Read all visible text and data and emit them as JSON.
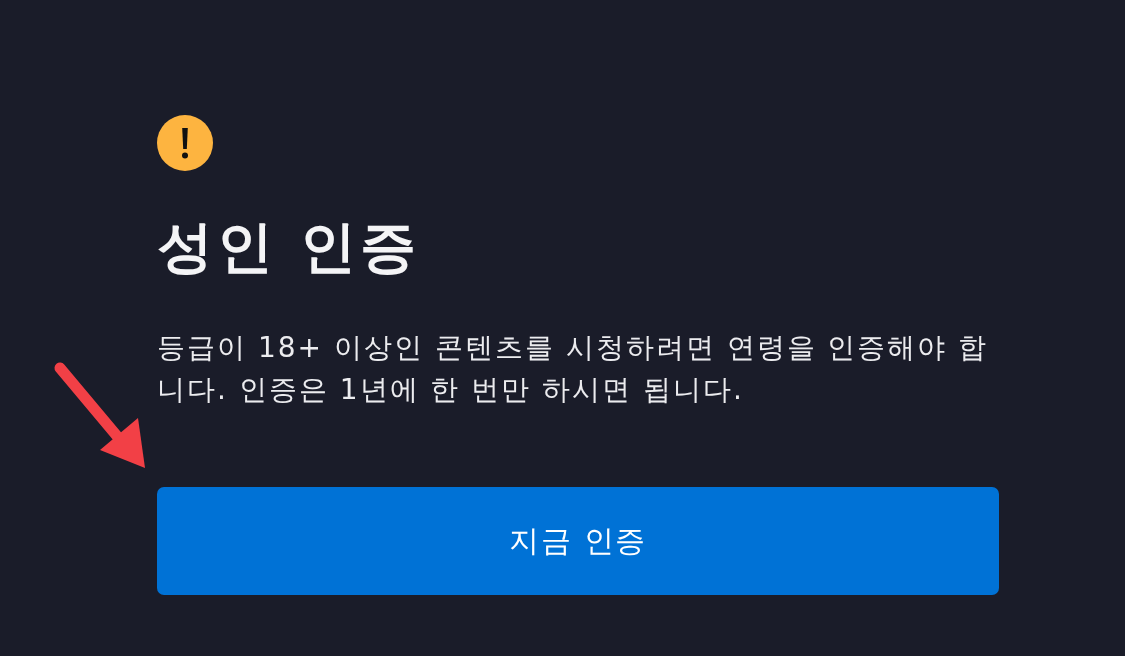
{
  "alert": {
    "title": "성인 인증",
    "message": "등급이 18+ 이상인 콘텐츠를 시청하려면 연령을 인증해야 합니다. 인증은 1년에 한 번만 하시면 됩니다.",
    "button": "지금 인증"
  }
}
